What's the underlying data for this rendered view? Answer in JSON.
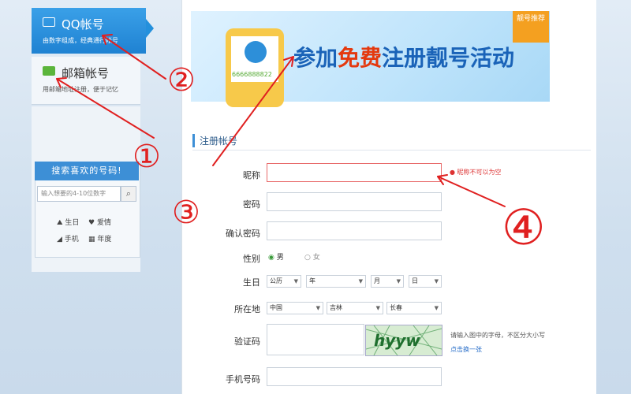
{
  "sidebar": {
    "qq_tab": {
      "title": "QQ帐号",
      "subtitle": "由数字组成，经典通行帐号"
    },
    "mail_tab": {
      "title": "邮箱帐号",
      "subtitle": "用邮箱地址注册，便于记忆"
    },
    "search": {
      "heading": "搜索喜欢的号码!",
      "placeholder": "输入想要的4-10位数字",
      "options": [
        "生日",
        "爱情",
        "手机",
        "年度"
      ]
    }
  },
  "banner": {
    "text_a": "参加",
    "text_free": "免费",
    "text_b": "注册靓号活动",
    "phone_number": "6666888822",
    "corner": "靓号推荐"
  },
  "form": {
    "section_title": "注册帐号",
    "nickname_label": "昵称",
    "nickname_error": "昵称不可以为空",
    "password_label": "密码",
    "confirm_label": "确认密码",
    "gender_label": "性别",
    "gender_male": "男",
    "gender_female": "女",
    "birthday_label": "生日",
    "birthday": {
      "calendar": "公历",
      "year": "年",
      "month": "月",
      "day": "日"
    },
    "location_label": "所在地",
    "location": {
      "country": "中国",
      "province": "吉林",
      "city": "长春"
    },
    "captcha_label": "验证码",
    "captcha_text": "hyyw",
    "captcha_hint": "请输入图中的字母，不区分大小写",
    "captcha_refresh": "点击换一张",
    "phone_label": "手机号码"
  },
  "annotations": [
    "①",
    "②",
    "③",
    "④"
  ],
  "colors": {
    "accent": "#1f82d2",
    "error": "#dd3333",
    "annotation": "#e02020"
  }
}
